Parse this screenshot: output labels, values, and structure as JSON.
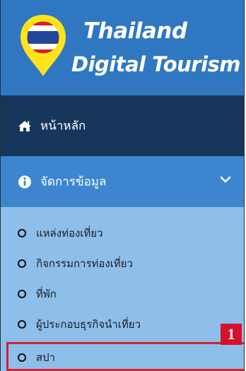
{
  "brand": {
    "line1": "Thailand",
    "line2": "Digital Tourism"
  },
  "menu": {
    "home": {
      "label": "หน้าหลัก",
      "icon": "home-icon"
    },
    "manage": {
      "label": "จัดการข้อมูล",
      "icon": "info-icon",
      "expanded": true
    },
    "submenu": [
      {
        "label": "แหล่งท่องเที่ยว",
        "icon": "circle-icon"
      },
      {
        "label": "กิจกรรมการท่องเที่ยว",
        "icon": "circle-icon"
      },
      {
        "label": "ที่พัก",
        "icon": "circle-icon"
      },
      {
        "label": "ผู้ประกอบธุรกิจนำเที่ยว",
        "icon": "circle-icon"
      },
      {
        "label": "สปา",
        "icon": "circle-icon"
      }
    ]
  },
  "annotation": {
    "label": "1"
  },
  "colors": {
    "brand_blue": "#2f78c1",
    "home_bg": "#16365c",
    "manage_bg": "#3d86cf",
    "submenu_bg": "#8ebeea",
    "highlight_red": "#cf2235"
  }
}
